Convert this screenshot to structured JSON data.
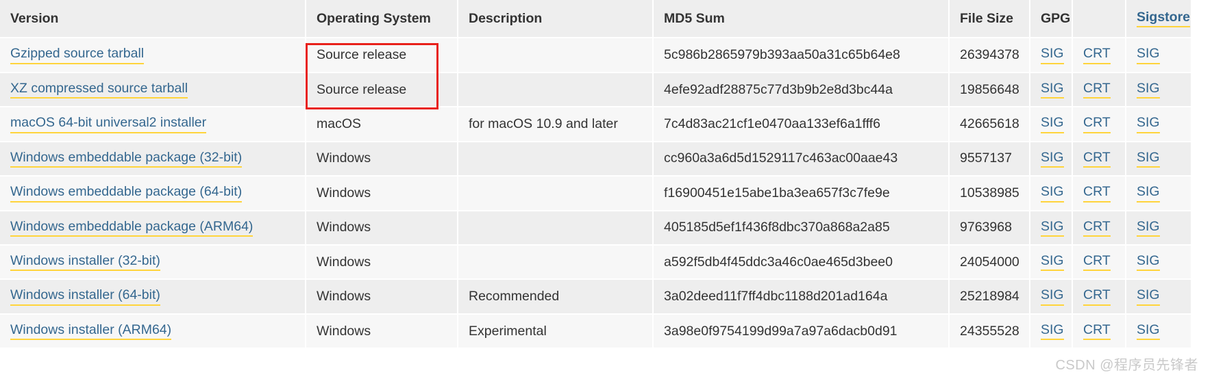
{
  "table": {
    "columns": [
      {
        "key": "version",
        "label": "Version",
        "is_link": false
      },
      {
        "key": "os",
        "label": "Operating System",
        "is_link": false
      },
      {
        "key": "desc",
        "label": "Description",
        "is_link": false
      },
      {
        "key": "md5",
        "label": "MD5 Sum",
        "is_link": false
      },
      {
        "key": "size",
        "label": "File Size",
        "is_link": false
      },
      {
        "key": "gpg",
        "label": "GPG",
        "is_link": false
      },
      {
        "key": "crt",
        "label": "",
        "is_link": false
      },
      {
        "key": "sigstore",
        "label": "Sigstore",
        "is_link": true
      }
    ],
    "rows": [
      {
        "version": "Gzipped source tarball",
        "os": "Source release",
        "desc": "",
        "md5": "5c986b2865979b393aa50a31c65b64e8",
        "size": "26394378",
        "gpg": "SIG",
        "crt": "CRT",
        "sigstore": "SIG"
      },
      {
        "version": "XZ compressed source tarball",
        "os": "Source release",
        "desc": "",
        "md5": "4efe92adf28875c77d3b9b2e8d3bc44a",
        "size": "19856648",
        "gpg": "SIG",
        "crt": "CRT",
        "sigstore": "SIG"
      },
      {
        "version": "macOS 64-bit universal2 installer",
        "os": "macOS",
        "desc": "for macOS 10.9 and later",
        "md5": "7c4d83ac21cf1e0470aa133ef6a1fff6",
        "size": "42665618",
        "gpg": "SIG",
        "crt": "CRT",
        "sigstore": "SIG"
      },
      {
        "version": "Windows embeddable package (32-bit)",
        "os": "Windows",
        "desc": "",
        "md5": "cc960a3a6d5d1529117c463ac00aae43",
        "size": "9557137",
        "gpg": "SIG",
        "crt": "CRT",
        "sigstore": "SIG"
      },
      {
        "version": "Windows embeddable package (64-bit)",
        "os": "Windows",
        "desc": "",
        "md5": "f16900451e15abe1ba3ea657f3c7fe9e",
        "size": "10538985",
        "gpg": "SIG",
        "crt": "CRT",
        "sigstore": "SIG"
      },
      {
        "version": "Windows embeddable package (ARM64)",
        "os": "Windows",
        "desc": "",
        "md5": "405185d5ef1f436f8dbc370a868a2a85",
        "size": "9763968",
        "gpg": "SIG",
        "crt": "CRT",
        "sigstore": "SIG"
      },
      {
        "version": "Windows installer (32-bit)",
        "os": "Windows",
        "desc": "",
        "md5": "a592f5db4f45ddc3a46c0ae465d3bee0",
        "size": "24054000",
        "gpg": "SIG",
        "crt": "CRT",
        "sigstore": "SIG"
      },
      {
        "version": "Windows installer (64-bit)",
        "os": "Windows",
        "desc": "Recommended",
        "md5": "3a02deed11f7ff4dbc1188d201ad164a",
        "size": "25218984",
        "gpg": "SIG",
        "crt": "CRT",
        "sigstore": "SIG"
      },
      {
        "version": "Windows installer (ARM64)",
        "os": "Windows",
        "desc": "Experimental",
        "md5": "3a98e0f9754199d99a7a97a6dacb0d91",
        "size": "24355528",
        "gpg": "SIG",
        "crt": "CRT",
        "sigstore": "SIG"
      }
    ]
  },
  "annotation": {
    "color": "#e8201a",
    "target": "operating-system-source-release-cells"
  },
  "watermark": {
    "text": "CSDN @程序员先锋者"
  },
  "colors": {
    "link": "#34678f",
    "link_underline": "#ffd43b",
    "header_bg": "#eeeeee",
    "row_odd_bg": "#f7f7f7",
    "row_even_bg": "#eeeeee",
    "text": "#333333",
    "annotation": "#e8201a"
  }
}
